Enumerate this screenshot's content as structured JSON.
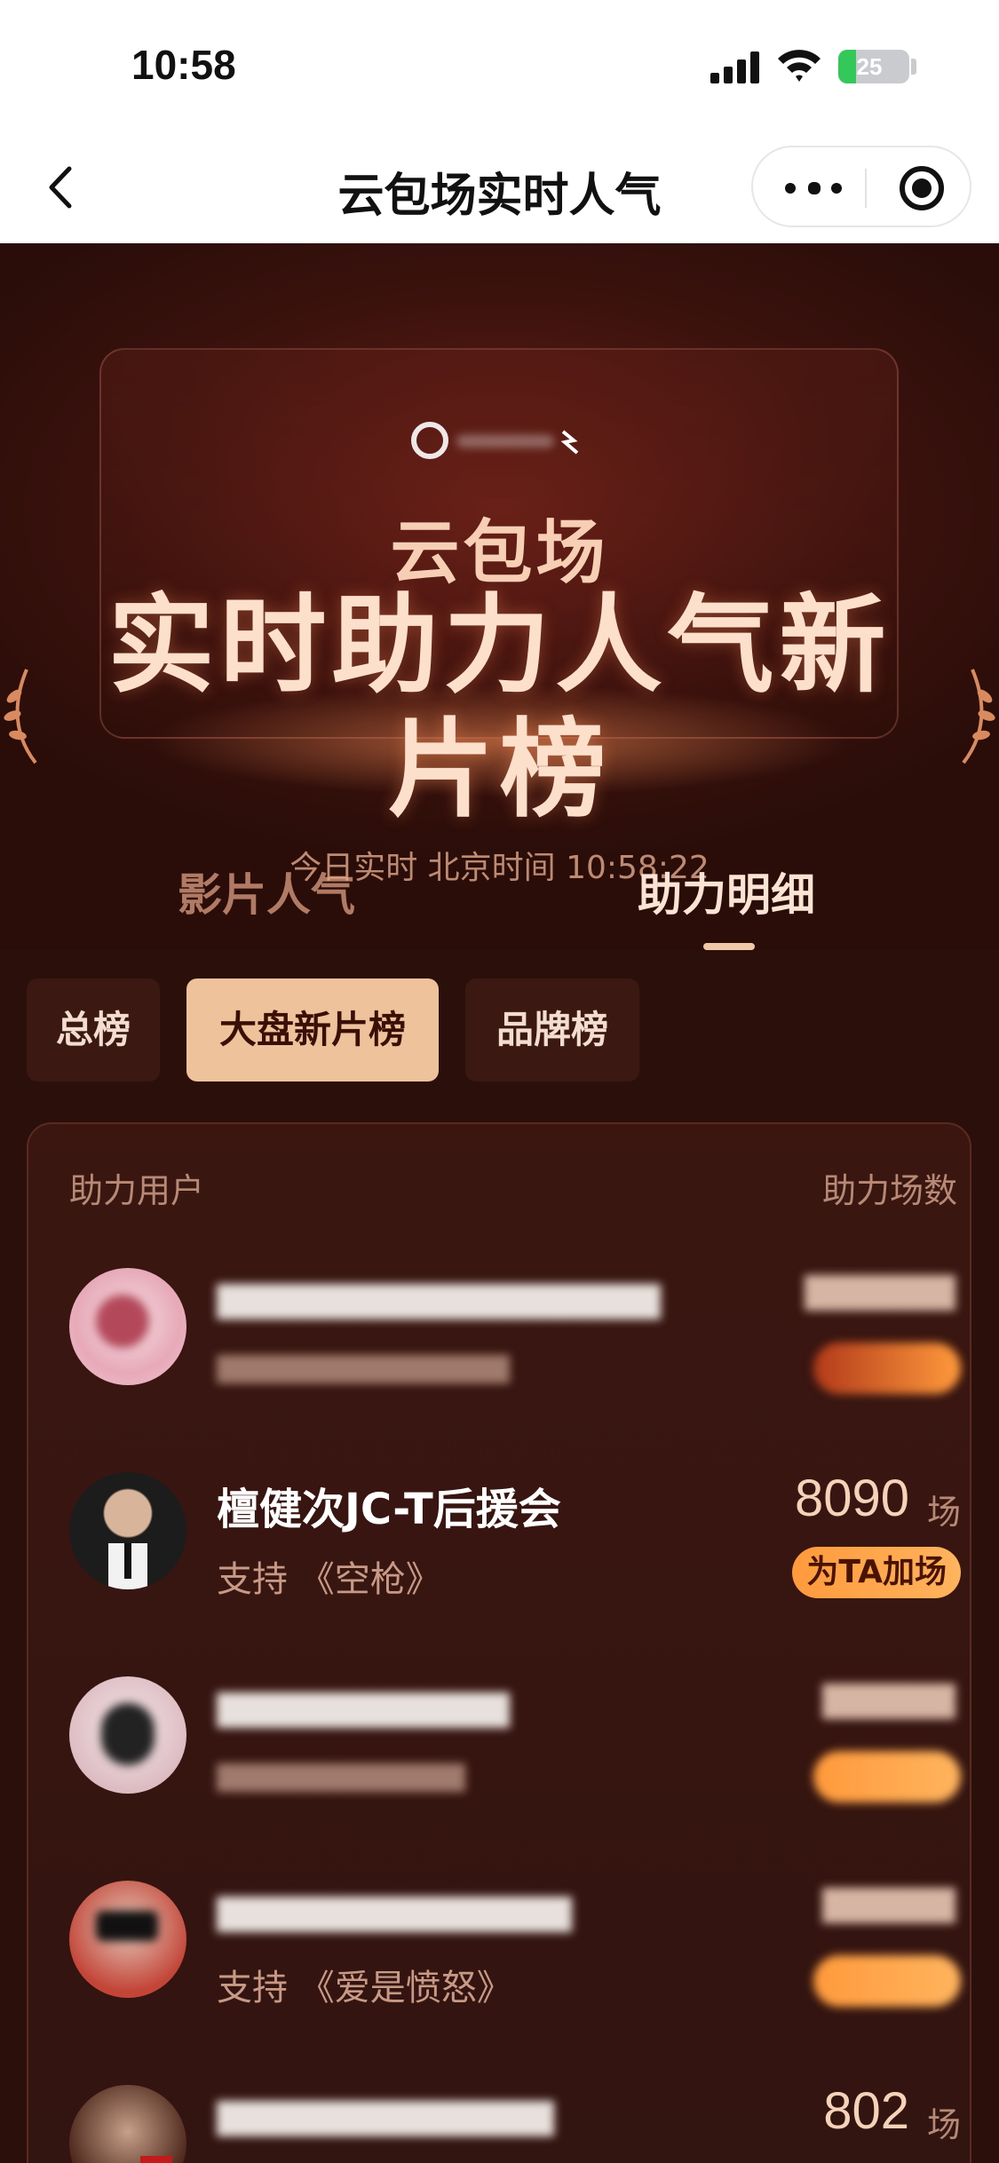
{
  "status_bar": {
    "time": "10:58",
    "battery_level": "25",
    "battery_percent": 25
  },
  "nav": {
    "title": "云包场实时人气"
  },
  "hero": {
    "subtitle": "云包场",
    "title": "实时助力人气新片榜",
    "realtime": "今日实时 北京时间 10:58:22"
  },
  "tabs": [
    {
      "label": "影片人气",
      "active": false
    },
    {
      "label": "助力明细",
      "active": true
    }
  ],
  "filters": [
    {
      "label": "总榜",
      "active": false
    },
    {
      "label": "大盘新片榜",
      "active": true
    },
    {
      "label": "品牌榜",
      "active": false
    }
  ],
  "table": {
    "col_user": "助力用户",
    "col_count": "助力场数",
    "unit": "场",
    "button_label": "为TA加场",
    "rows": [
      {
        "name": "",
        "support": "",
        "count": "",
        "avatar_color": "#f2c6d0"
      },
      {
        "name": "檀健次JC-T后援会",
        "support": "支持 《空枪》",
        "count": "8090",
        "avatar_color": "#1a1a1a"
      },
      {
        "name": "",
        "support": "",
        "count": "",
        "avatar_color": "#e8d0d4"
      },
      {
        "name": "",
        "support": "支持 《爱是愤怒》",
        "count": "",
        "avatar_color": "#d4534a"
      },
      {
        "name": "",
        "support": "",
        "count": "802",
        "avatar_color": "#6b3a2a"
      }
    ]
  }
}
